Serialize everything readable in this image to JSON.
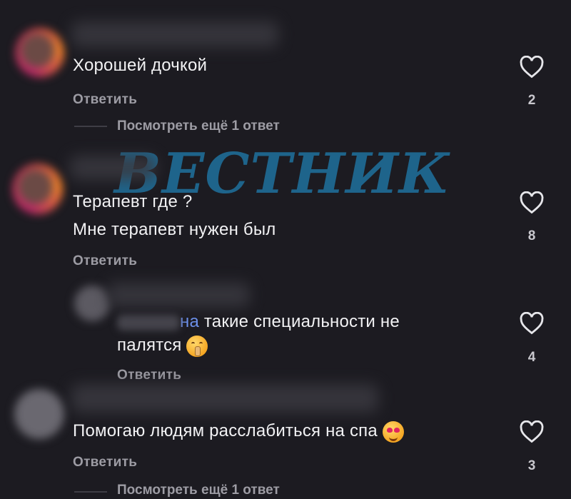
{
  "watermark": "ВЕСТНИК",
  "comments": [
    {
      "text": "Хорошей дочкой",
      "reply_label": "Ответить",
      "likes": "2",
      "view_more": "Посмотреть ещё 1 ответ"
    },
    {
      "text_line1": "Терапевт где ?",
      "text_line2": "Мне терапевт нужен был",
      "reply_label": "Ответить",
      "likes": "8"
    },
    {
      "mention_visible": "на",
      "text_line1": " такие специальности не",
      "text_line2": "палятся",
      "emoji": "shushing-face",
      "reply_label": "Ответить",
      "likes": "4"
    },
    {
      "text": "Помогаю людям расслабиться на спа",
      "emoji": "heart-eyes-face",
      "reply_label": "Ответить",
      "likes": "3",
      "view_more": "Посмотреть ещё 1 ответ"
    }
  ],
  "colors": {
    "background": "#1c1b21",
    "secondary_text": "#9d9ca4",
    "mention": "#6c8fe8",
    "watermark": "#1f6f9a"
  }
}
